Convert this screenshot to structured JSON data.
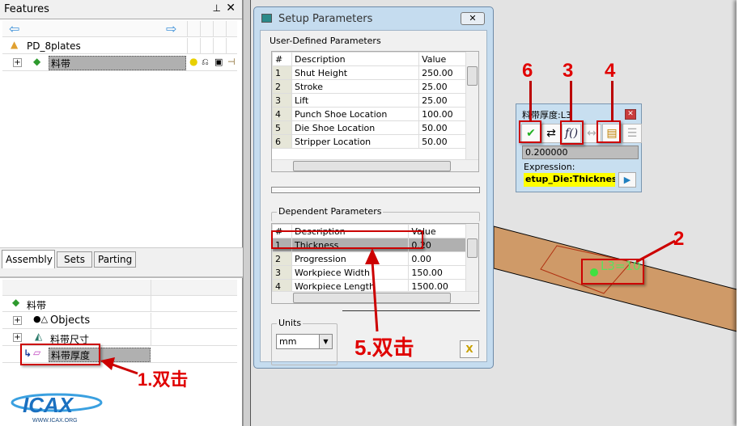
{
  "features_panel": {
    "title": "Features",
    "pin_icon": "pin-icon",
    "close_icon": "close-icon",
    "tree": [
      {
        "label": "PD_8plates",
        "icon": "assembly-icon"
      },
      {
        "label": "料带",
        "icon": "strip-icon",
        "selected": true
      }
    ]
  },
  "left_tabs": [
    "Assembly",
    "Sets",
    "Parting"
  ],
  "bottom_tree": [
    {
      "label": "料带"
    },
    {
      "label": "Objects"
    },
    {
      "label": "料带尺寸"
    },
    {
      "label": "料带厚度",
      "selected": true
    }
  ],
  "setup_dialog": {
    "title": "Setup Parameters",
    "user_defined": {
      "label": "User-Defined Parameters",
      "columns": [
        "#",
        "Description",
        "Value"
      ],
      "rows": [
        [
          "1",
          "Shut Height",
          "250.00"
        ],
        [
          "2",
          "Stroke",
          "25.00"
        ],
        [
          "3",
          "Lift",
          "25.00"
        ],
        [
          "4",
          "Punch Shoe Location",
          "100.00"
        ],
        [
          "5",
          "Die Shoe Location",
          "50.00"
        ],
        [
          "6",
          "Stripper Location",
          "50.00"
        ]
      ]
    },
    "dependent": {
      "label": "Dependent Parameters",
      "columns": [
        "#",
        "Description",
        "Value"
      ],
      "rows": [
        [
          "1",
          "Thickness",
          "0.20"
        ],
        [
          "2",
          "Progression",
          "0.00"
        ],
        [
          "3",
          "Workpiece Width",
          "150.00"
        ],
        [
          "4",
          "Workpiece Length",
          "1500.00"
        ]
      ]
    },
    "units": {
      "label": "Units",
      "value": "mm"
    }
  },
  "mini_dialog": {
    "title": "料带厚度:L3",
    "value": "0.200000",
    "expression_label": "Expression:",
    "expression": "etup_Die:Thickness"
  },
  "viewport": {
    "dimension_label": "L3=10",
    "strip_color": "#cf9a68"
  },
  "annotations": {
    "a1": "1.双击",
    "a2": "2",
    "a3": "3",
    "a4": "4",
    "a5": "5.双击",
    "a6": "6",
    "color": "#e00000"
  },
  "logo": {
    "text": "ICAX",
    "url_text": "WWW.ICAX.ORG"
  }
}
